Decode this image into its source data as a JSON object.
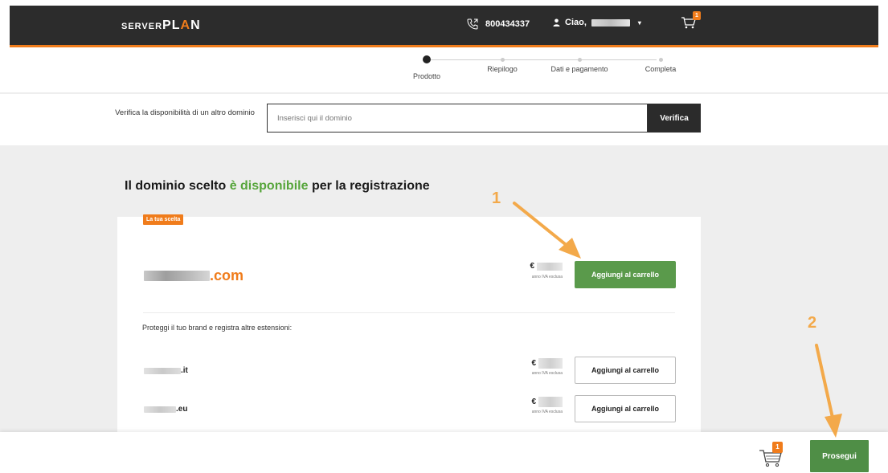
{
  "header": {
    "logo_small": "SERVER",
    "logo_big_1": "PL",
    "logo_big_a": "A",
    "logo_big_2": "N",
    "phone": "800434337",
    "greeting": "Ciao,",
    "cart_count": "1",
    "accent": "#f07c1b",
    "bar_color": "#2c2c2c"
  },
  "steps": [
    {
      "label": "Prodotto",
      "active": true
    },
    {
      "label": "Riepilogo",
      "active": false
    },
    {
      "label": "Dati e pagamento",
      "active": false
    },
    {
      "label": "Completa",
      "active": false
    }
  ],
  "check": {
    "label": "Verifica la disponibilità di un altro dominio",
    "placeholder": "Inserisci qui il dominio",
    "button": "Verifica"
  },
  "result": {
    "headline_prefix": "Il dominio scelto",
    "headline_status": "è disponibile",
    "headline_suffix": "per la registrazione",
    "tag": "La tua scelta",
    "main_ext": ".com",
    "currency": "€",
    "price_note": "anno IVA esclusa",
    "add_label": "Aggiungi al carrello",
    "protect_text": "Proteggi il tuo brand e registra altre estensioni:",
    "extensions": [
      {
        "ext": ".it",
        "add_label": "Aggiungi al carrello"
      },
      {
        "ext": ".eu",
        "add_label": "Aggiungi al carrello"
      }
    ],
    "green": "#56a53b"
  },
  "footer": {
    "cart_count": "1",
    "continue": "Prosegui"
  },
  "annotations": {
    "one": "1",
    "two": "2",
    "color": "#f3a94a"
  }
}
